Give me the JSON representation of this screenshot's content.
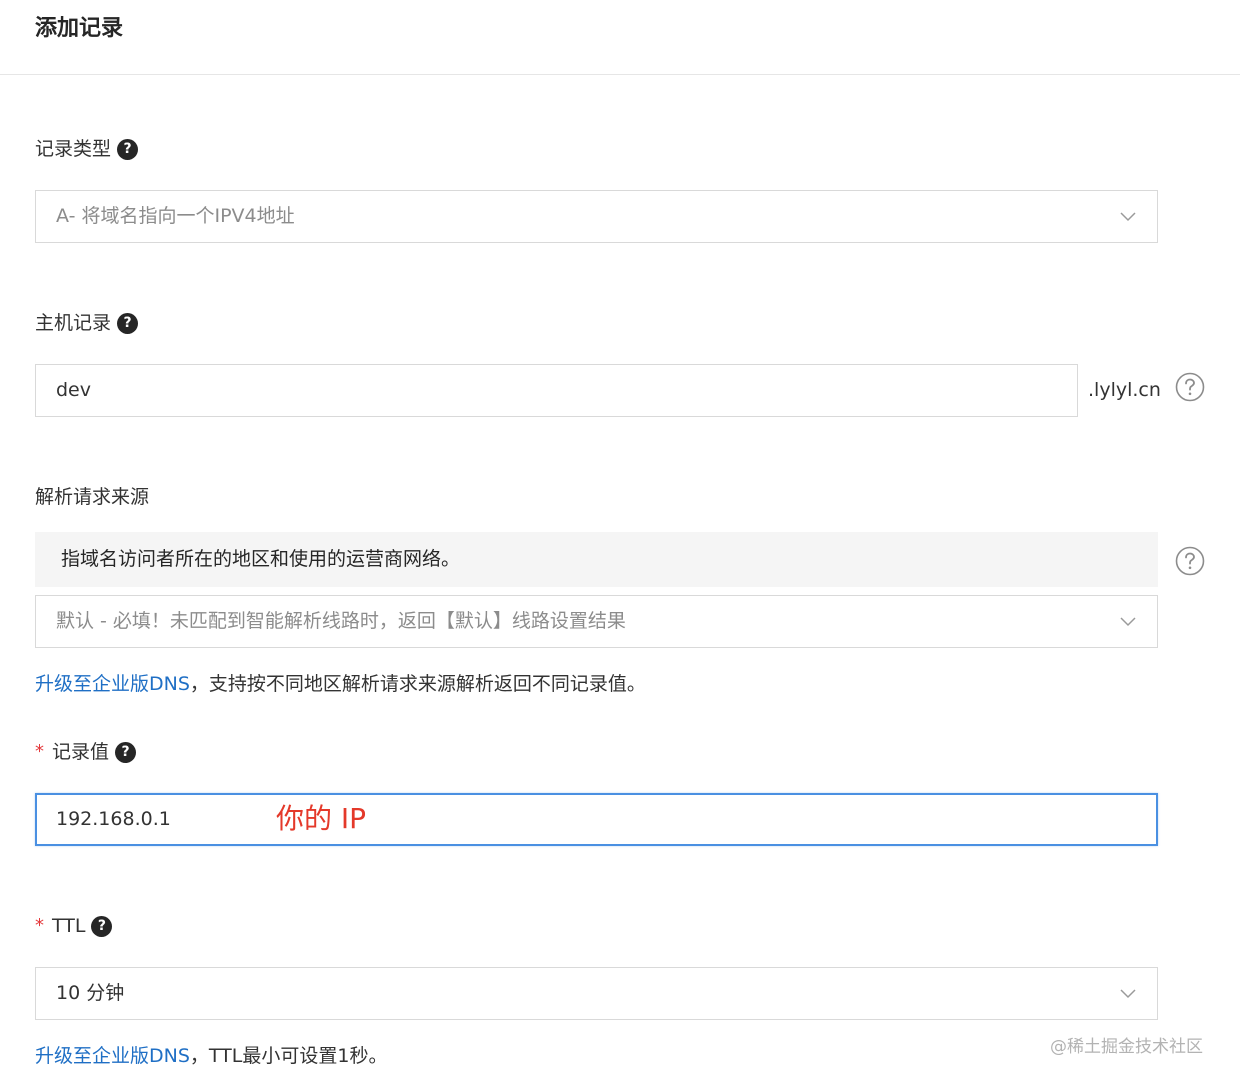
{
  "dialog": {
    "title": "添加记录"
  },
  "record_type": {
    "label": "记录类型",
    "value": "A- 将域名指向一个IPV4地址"
  },
  "host_record": {
    "label": "主机记录",
    "value": "dev",
    "suffix": ".lylyl.cn"
  },
  "resolution_source": {
    "label": "解析请求来源",
    "info": "指域名访问者所在的地区和使用的运营商网络。",
    "value": "默认 - 必填！未匹配到智能解析线路时，返回【默认】线路设置结果",
    "tip_link": "升级至企业版DNS",
    "tip_text": "，支持按不同地区解析请求来源解析返回不同记录值。"
  },
  "record_value": {
    "required_mark": "*",
    "label": "记录值",
    "value": "192.168.0.1",
    "annotation": "你的 IP"
  },
  "ttl": {
    "required_mark": "*",
    "label": "TTL",
    "value": "10 分钟",
    "tip_link": "升级至企业版DNS",
    "tip_text": "，TTL最小可设置1秒。"
  },
  "help_glyph": "?",
  "watermark": "@稀土掘金技术社区",
  "colors": {
    "link": "#1f6fc5",
    "focus_border": "#4a90e2",
    "required": "#e4393c",
    "annotation": "#e4392a"
  }
}
